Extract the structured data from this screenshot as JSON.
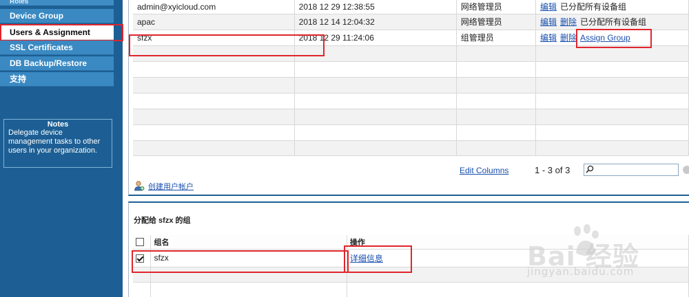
{
  "sidebar": {
    "cut_label": "Roles",
    "items": [
      {
        "label": "Device Group"
      },
      {
        "label": "Users & Assignment"
      },
      {
        "label": "SSL Certificates"
      },
      {
        "label": "DB Backup/Restore"
      },
      {
        "label": "支持"
      }
    ],
    "notes": {
      "title": "Notes",
      "body": "Delegate device management tasks to other users in your organization."
    }
  },
  "users_table": {
    "rows": [
      {
        "user": "admin@xyicloud.com",
        "date": "2018 12 29 12:38:55",
        "role": "网络管理员",
        "edit": "编辑",
        "delete": "",
        "assign": "",
        "status": "已分配所有设备组"
      },
      {
        "user": "apac",
        "date": "2018 12 14 12:04:32",
        "role": "网络管理员",
        "edit": "编辑",
        "delete": "删除",
        "assign": "",
        "status": "已分配所有设备组"
      },
      {
        "user": "sfzx",
        "date": "2018 12 29 11:24:06",
        "role": "组管理员",
        "edit": "编辑",
        "delete": "删除",
        "assign": "Assign Group",
        "status": ""
      }
    ],
    "edit_columns": "Edit Columns",
    "page_count": "1 - 3 of 3",
    "search": {
      "value": "",
      "placeholder": ""
    },
    "create_user": "创建用户帐户"
  },
  "assignment": {
    "title": "分配给 sfzx 的组",
    "headers": {
      "name": "组名",
      "action": "操作"
    },
    "rows": [
      {
        "checked": true,
        "name": "sfzx",
        "action": "详细信息"
      }
    ]
  },
  "watermark": {
    "brand": "Bai 经验",
    "url": "jingyan.baidu.com"
  }
}
